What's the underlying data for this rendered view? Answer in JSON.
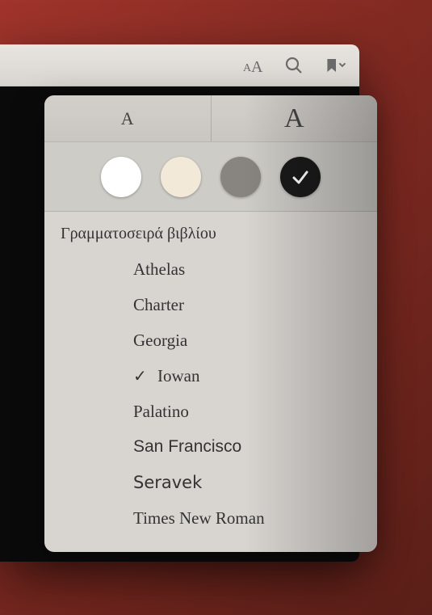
{
  "toolbar": {
    "appearance_icon": "appearance-icon",
    "search_icon": "search-icon",
    "bookmark_icon": "bookmark-icon"
  },
  "sizes": {
    "small_label": "A",
    "large_label": "A"
  },
  "themes": {
    "options": [
      "white",
      "sepia",
      "gray",
      "night"
    ],
    "selected": "night"
  },
  "fonts": {
    "header": "Γραμματοσειρά βιβλίου",
    "items": [
      {
        "label": "Athelas",
        "class": "f-athelas",
        "selected": false
      },
      {
        "label": "Charter",
        "class": "f-charter",
        "selected": false
      },
      {
        "label": "Georgia",
        "class": "f-georgia",
        "selected": false
      },
      {
        "label": "Iowan",
        "class": "f-iowan",
        "selected": true
      },
      {
        "label": "Palatino",
        "class": "f-palatino",
        "selected": false
      },
      {
        "label": "San Francisco",
        "class": "f-sanfrancisco",
        "selected": false
      },
      {
        "label": "Seravek",
        "class": "f-seravek",
        "selected": false
      },
      {
        "label": "Times New Roman",
        "class": "f-times",
        "selected": false
      }
    ]
  }
}
